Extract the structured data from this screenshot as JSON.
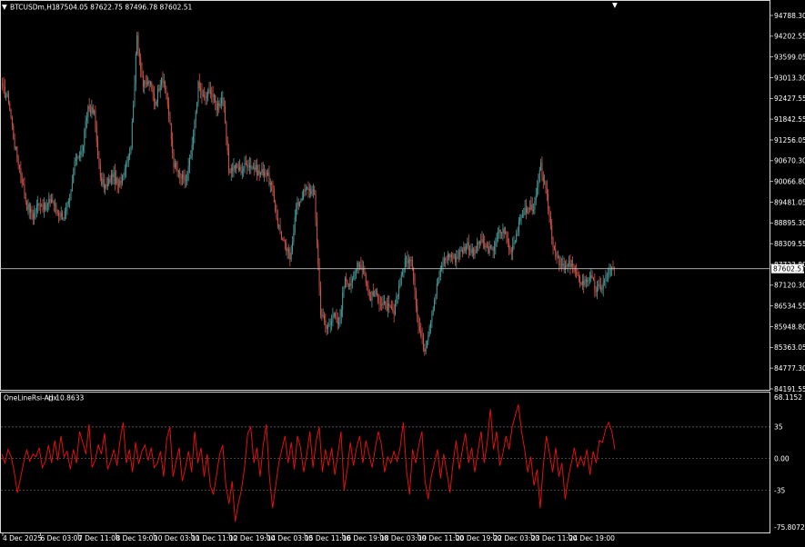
{
  "window": {
    "symbol_header": "BTCUSDm,H1",
    "ohlc_header": "87504.05 87622.75 87496.78 87602.51",
    "indicator_header": "OneLineRsi-Adx",
    "indicator_value": "() 10.8633"
  },
  "colors": {
    "background": "#000000",
    "foreground": "#ffffff",
    "bull_candle": "#4a9d9c",
    "bear_candle": "#d4554a",
    "indicator_line": "#e01010",
    "bid_line": "#c0c0c0",
    "price_tag_bg": "#ffffff",
    "price_tag_text": "#000000",
    "level_lines": "#6e6e6e"
  },
  "chart_data": [
    {
      "type": "candlestick",
      "symbol": "BTCUSDm",
      "timeframe": "H1",
      "y_ticks": [
        "94788.30",
        "94202.55",
        "93599.05",
        "93013.30",
        "92427.55",
        "91842.55",
        "91256.05",
        "90670.30",
        "90066.80",
        "89481.05",
        "88895.30",
        "88309.55",
        "87723.80",
        "87120.30",
        "86534.55",
        "85948.80",
        "85363.05",
        "84777.30",
        "84191.55"
      ],
      "ylim": [
        84191.55,
        94788.3
      ],
      "current_price": 87602.51,
      "current_price_label": "87602.51",
      "x_ticks": [
        "4 Dec 2025",
        "6 Dec 03:00",
        "7 Dec 11:00",
        "8 Dec 19:00",
        "10 Dec 03:00",
        "11 Dec 11:00",
        "12 Dec 19:00",
        "14 Dec 03:00",
        "15 Dec 11:00",
        "16 Dec 19:00",
        "18 Dec 03:00",
        "19 Dec 11:00",
        "20 Dec 19:00",
        "22 Dec 03:00",
        "23 Dec 11:00",
        "24 Dec 19:00"
      ],
      "close_path": [
        92700,
        92400,
        91100,
        90300,
        89400,
        89100,
        89500,
        89300,
        89600,
        89200,
        89100,
        89500,
        90800,
        90900,
        92200,
        92000,
        90100,
        89900,
        90300,
        89900,
        90500,
        91100,
        94200,
        92800,
        92900,
        92300,
        93100,
        92300,
        90600,
        90200,
        90100,
        91000,
        92800,
        92400,
        92700,
        92200,
        92500,
        90400,
        90500,
        90400,
        90600,
        90500,
        90300,
        90400,
        89900,
        88900,
        88300,
        87900,
        89300,
        89700,
        89900,
        89700,
        86400,
        85900,
        86300,
        86000,
        87400,
        87100,
        87800,
        87600,
        86800,
        86900,
        86600,
        86500,
        86300,
        87300,
        87900,
        87700,
        86000,
        85300,
        86200,
        87100,
        87800,
        88000,
        87900,
        88100,
        88300,
        88000,
        88400,
        88200,
        88100,
        88600,
        88700,
        88100,
        88600,
        89200,
        89300,
        89400,
        90500,
        89600,
        88300,
        87700,
        87600,
        87800,
        87300,
        87200,
        87400,
        87000,
        87100,
        87500,
        87602
      ]
    },
    {
      "type": "line",
      "name": "OneLineRsi-Adx",
      "y_ticks": [
        "68.1152",
        "35",
        "0.00",
        "-35",
        "-75.8072"
      ],
      "ylim": [
        -75.8072,
        68.1152
      ],
      "levels": [
        35,
        0,
        -35
      ],
      "values": [
        5,
        -5,
        10,
        2,
        -15,
        -38,
        -22,
        -5,
        10,
        -3,
        5,
        2,
        12,
        -10,
        -3,
        15,
        -5,
        20,
        -2,
        25,
        2,
        8,
        -12,
        10,
        -5,
        30,
        18,
        5,
        38,
        -10,
        -2,
        15,
        5,
        28,
        -12,
        -3,
        10,
        -8,
        20,
        40,
        -5,
        10,
        -15,
        18,
        -6,
        8,
        15,
        -2,
        12,
        -10,
        -5,
        8,
        -20,
        22,
        35,
        -20,
        -3,
        12,
        -25,
        -10,
        8,
        -15,
        30,
        -5,
        12,
        -20,
        5,
        -30,
        -40,
        -18,
        5,
        15,
        -30,
        -50,
        -25,
        -70,
        -50,
        -35,
        -10,
        28,
        35,
        -5,
        12,
        -20,
        15,
        38,
        -20,
        -55,
        -30,
        -5,
        10,
        25,
        -5,
        18,
        -12,
        25,
        12,
        -15,
        5,
        30,
        -10,
        20,
        35,
        -15,
        10,
        -8,
        12,
        -18,
        5,
        30,
        -35,
        -12,
        18,
        -8,
        12,
        25,
        -5,
        20,
        5,
        -10,
        12,
        30,
        15,
        -15,
        2,
        -5,
        8,
        -3,
        12,
        40,
        -12,
        -40,
        10,
        -5,
        15,
        30,
        -25,
        -45,
        -20,
        -5,
        10,
        -22,
        5,
        -15,
        -38,
        -5,
        20,
        -12,
        10,
        28,
        -5,
        12,
        -15,
        8,
        30,
        -5,
        18,
        55,
        10,
        30,
        -8,
        5,
        25,
        10,
        35,
        48,
        60,
        30,
        10,
        -15,
        2,
        -30,
        -12,
        -55,
        -8,
        25,
        5,
        -15,
        12,
        -20,
        -5,
        -45,
        -22,
        -5,
        12,
        -10,
        2,
        -8,
        10,
        -18,
        8,
        -5,
        20,
        18,
        32,
        40,
        30,
        10
      ]
    }
  ]
}
